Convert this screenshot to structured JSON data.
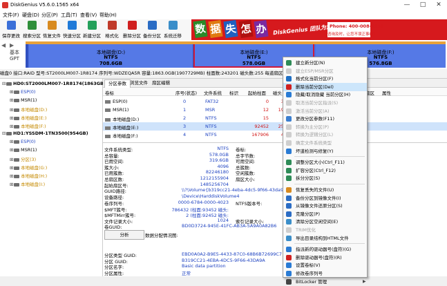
{
  "window": {
    "title": "DiskGenius V5.6.0.1565 x64",
    "controls": [
      "—",
      "□",
      "✕"
    ]
  },
  "menu": [
    "文件(F)",
    "硬盘(D)",
    "分区(P)",
    "工具(T)",
    "查看(V)",
    "帮助(H)"
  ],
  "toolbar": [
    {
      "label": "保存更改",
      "icon": "save-icon",
      "color": "#3a6fd8"
    },
    {
      "label": "搜索分区",
      "icon": "search-icon",
      "color": "#2f8f3a"
    },
    {
      "label": "恢复文件",
      "icon": "recover-icon",
      "color": "#d88a1f"
    },
    {
      "label": "快速分区",
      "icon": "quick-partition-icon",
      "color": "#1f7ad8"
    },
    {
      "label": "新建分区",
      "icon": "new-partition-icon",
      "color": "#24a05a"
    },
    {
      "label": "格式化",
      "icon": "format-icon",
      "color": "#c03a2a"
    },
    {
      "label": "删除分区",
      "icon": "delete-icon",
      "color": "#d02020"
    },
    {
      "label": "备份分区",
      "icon": "backup-icon",
      "color": "#2b6cc4"
    },
    {
      "label": "系统迁移",
      "icon": "migrate-icon",
      "color": "#3b8ec9"
    }
  ],
  "banner": {
    "chars": [
      "数",
      "据",
      "失",
      "怎",
      "办"
    ],
    "slogan": "DiskGenius 团队为您服务",
    "phone": "Phone: 400-008-9958",
    "qq": "咨询及时，让您不误正事QQ",
    "bg_color": "#d6191d"
  },
  "diskmap": {
    "nav_left": "◀",
    "nav_right": "▶",
    "label_line1": "基本",
    "label_line2": "GPT",
    "segments": [
      {
        "name": "本地磁盘(D:)",
        "fs": "NTFS",
        "size": "708.6GB",
        "color": "#5579e6"
      },
      {
        "name": "本地磁盘(E:)",
        "fs": "NTFS",
        "size": "578.0GB",
        "color": "#5579e6"
      },
      {
        "name": "本地磁盘(F:)",
        "fs": "NTFS",
        "size": "576.8GB",
        "color": "#5579e6"
      }
    ]
  },
  "diskinfo": "磁盘0 接口:RAID  型号:ST2000LM007-1R8174  序列号:WDZEQA5R  容量:1863.0GB(1907729MB)  柱面数:243201  磁头数:255  每道扇区数:63  总扇区数:3907029168",
  "tree": [
    {
      "text": "HD0:ST2000LM007-1R8174(1863GB)",
      "exp": "⊟",
      "bold": true,
      "color": "#000"
    },
    {
      "text": "ESP(0)",
      "exp": "⊞",
      "color": "#1a3fc0"
    },
    {
      "text": "MSR(1)",
      "exp": "⊞",
      "color": "#000"
    },
    {
      "text": "本地磁盘(D:)",
      "exp": "⊞",
      "color": "#c58a00"
    },
    {
      "text": "本地磁盘(E:)",
      "exp": "⊞",
      "color": "#c58a00"
    },
    {
      "text": "本地磁盘(F:)",
      "exp": "⊞",
      "color": "#c58a00"
    },
    {
      "text": "HD1:YSSDM-1TN3500(954GB)",
      "exp": "⊟",
      "bold": true,
      "color": "#000"
    },
    {
      "text": "ESP(0)",
      "exp": "⊞",
      "color": "#1a3fc0"
    },
    {
      "text": "MSR(1)",
      "exp": "⊞",
      "color": "#000"
    },
    {
      "text": "分区(3)",
      "exp": "⊞",
      "color": "#c58a00"
    },
    {
      "text": "本地磁盘(G:)",
      "exp": "⊞",
      "color": "#c58a00"
    },
    {
      "text": "本地磁盘(H:)",
      "exp": "⊞",
      "color": "#c58a00"
    },
    {
      "text": "本地磁盘(I:)",
      "exp": "⊞",
      "color": "#c58a00"
    }
  ],
  "tabs": [
    "分区参数",
    "浏览文件",
    "扇区编辑"
  ],
  "table": {
    "headers": [
      "卷标",
      "序号(状态)",
      "文件系统",
      "标识",
      "起始柱面",
      "磁头",
      "扇区",
      "属性"
    ],
    "rows": [
      {
        "vol": "ESP(0)",
        "num": "0",
        "fs": "FAT32",
        "cyl": "0",
        "head": "32",
        "sect": "",
        "attr": "",
        "volc": "bl"
      },
      {
        "vol": "MSR(1)",
        "num": "1",
        "fs": "MSR",
        "cyl": "12",
        "head": "190",
        "sect": "",
        "attr": "",
        "volc": ""
      },
      {
        "vol": "本地磁盘(D:)",
        "num": "2",
        "fs": "NTFS",
        "cyl": "15",
        "head": "",
        "sect": "",
        "attr": "",
        "volc": "bl"
      },
      {
        "vol": "本地磁盘(E:)",
        "num": "3",
        "fs": "NTFS",
        "cyl": "92452",
        "head": "254",
        "sect": "",
        "attr": "",
        "volc": "bl",
        "sel": true
      },
      {
        "vol": "本地磁盘(F:)",
        "num": "4",
        "fs": "NTFS",
        "cyl": "167906",
        "head": "43",
        "sect": "",
        "attr": "",
        "volc": "bl"
      }
    ]
  },
  "details1": [
    {
      "k": "文件系统类型:",
      "v": "NTFS",
      "k2": "卷标:",
      "v2": ""
    },
    {
      "k": "总容量:",
      "v": "578.0GB",
      "k2": "总字节数:",
      "v2": ""
    },
    {
      "k": "已用空间:",
      "v": "319.6GB",
      "k2": "可用空间:",
      "v2": ""
    },
    {
      "k": "簇大小:",
      "v": "4096",
      "k2": "总簇数:",
      "v2": ""
    },
    {
      "k": "已用簇数:",
      "v": "82246180",
      "k2": "空闲簇数:",
      "v2": ""
    },
    {
      "k": "总扇区数:",
      "v": "1212155904",
      "k2": "扇区大小:",
      "v2": ""
    },
    {
      "k": "起始扇区号:",
      "v": "1485256704",
      "k2": "",
      "v2": ""
    },
    {
      "k": "GUID路径:",
      "v": "\\\\?\\Volume{b319cc21-4eba-4dc5-9f66-43da9a8",
      "k2": "",
      "v2": ""
    },
    {
      "k": "设备路径:",
      "v": "\\Device\\HarddiskVolume4",
      "k2": "",
      "v2": ""
    }
  ],
  "details2": [
    {
      "k": "卷序列号:",
      "v": "0000-6784-0000-4023",
      "k2": "NTFS版本号:",
      "v2": ""
    },
    {
      "k": "$MFT簇号:",
      "v": "786432 (柱面:93452 磁头:",
      "k2": "",
      "v2": ""
    },
    {
      "k": "$MFTMirr簇号:",
      "v": "2 (柱面:92452 磁头:",
      "k2": "",
      "v2": ""
    },
    {
      "k": "文件记录大小:",
      "v": "1024",
      "k2": "索引记录大小:",
      "v2": ""
    },
    {
      "k": "卷GUID:",
      "v": "BD0D3724-945E-41FC-AB3A-5A9A0A82B6",
      "k2": "",
      "v2": ""
    }
  ],
  "analyze": {
    "button": "分析",
    "label": "数据分配情况图:"
  },
  "details3": [
    {
      "k": "分区类型 GUID:",
      "v": "EBD0A0A2-B9E5-4433-87C0-68B6B72699C7"
    },
    {
      "k": "分区 GUID:",
      "v": "B319CC21-4EBA-4DC5-9F66-43DA9A"
    },
    {
      "k": "分区名字:",
      "v": "Basic data partition"
    },
    {
      "k": "分区属性:",
      "v": "正常"
    }
  ],
  "context_menu": [
    {
      "label": "建立新分区(N)",
      "icon": "new-partition-icon",
      "color": "#2e8b57",
      "disabled": false
    },
    {
      "label": "建立ESP/MSR分区",
      "icon": "esp-icon",
      "color": "#999999",
      "disabled": true
    },
    {
      "label": "格式化当前分区(F)",
      "icon": "format-icon",
      "color": "#1f6fc4",
      "disabled": false
    },
    {
      "label": "删除当前分区(Del)",
      "icon": "delete-icon",
      "color": "#d02020",
      "disabled": false,
      "highlight": true
    },
    {
      "label": "隐藏/取消隐藏 当前分区(H)",
      "icon": "hide-icon",
      "color": "#2a7bd4",
      "disabled": false
    },
    {
      "label": "取消当前分区指派(S)",
      "icon": "unassign-icon",
      "color": "#999999",
      "disabled": true
    },
    {
      "label": "激活当前分区(A)",
      "icon": "activate-icon",
      "color": "#999999",
      "disabled": true
    },
    {
      "label": "更改分区参数(F11)",
      "icon": "params-icon",
      "color": "#3c7fd0",
      "disabled": false
    },
    {
      "label": "转换为主分区(P)",
      "icon": "convert-icon",
      "color": "#999999",
      "disabled": true
    },
    {
      "label": "转换为逻辑分区(L)",
      "icon": "convert-icon",
      "color": "#999999",
      "disabled": true
    },
    {
      "label": "确定文件系统类型",
      "icon": "check-icon",
      "color": "#999999",
      "disabled": true
    },
    {
      "label": "坏道检测与修复(Y)",
      "icon": "badsector-icon",
      "color": "#2a7bd4",
      "disabled": false
    },
    {
      "sep": true
    },
    {
      "label": "调整分区大小(Ctrl_F11)",
      "icon": "resize-icon",
      "color": "#2e8b57",
      "disabled": false
    },
    {
      "label": "扩容分区(Ctrl_F12)",
      "icon": "extend-icon",
      "color": "#2e8b57",
      "disabled": false
    },
    {
      "label": "拆分分区(S)",
      "icon": "split-icon",
      "color": "#2e8b57",
      "disabled": false
    },
    {
      "sep": true
    },
    {
      "label": "恢复丢失的文件(U)",
      "icon": "recover-icon",
      "color": "#d88a1f",
      "disabled": false
    },
    {
      "label": "备份分区到镜像文件(I)",
      "icon": "backup-icon",
      "color": "#2b6cc4",
      "disabled": false
    },
    {
      "label": "从镜像文件还原分区(S)",
      "icon": "restore-icon",
      "color": "#2b6cc4",
      "disabled": false
    },
    {
      "label": "克隆分区(P)",
      "icon": "clone-icon",
      "color": "#2b6cc4",
      "disabled": false
    },
    {
      "label": "清除分区空闲空间(E)",
      "icon": "wipe-icon",
      "color": "#3b8ec9",
      "disabled": false
    },
    {
      "label": "TRIM优化",
      "icon": "trim-icon",
      "color": "#999999",
      "disabled": true
    },
    {
      "label": "导出目录结构到HTML文件",
      "icon": "export-icon",
      "color": "#3b8ec9",
      "disabled": false
    },
    {
      "sep": true
    },
    {
      "label": "指派新的驱动器号(盘符)(G)",
      "icon": "drive-letter-icon",
      "color": "#2a7bd4",
      "disabled": false
    },
    {
      "label": "删除驱动器号(盘符)(R)",
      "icon": "remove-letter-icon",
      "color": "#d02020",
      "disabled": false
    },
    {
      "label": "设置卷标(V)",
      "icon": "label-icon",
      "color": "#2a7bd4",
      "disabled": false
    },
    {
      "label": "修改卷序列号",
      "icon": "serial-icon",
      "color": "#2a7bd4",
      "disabled": false
    },
    {
      "label": "BitLocker 管理",
      "icon": "lock-icon",
      "color": "#444444",
      "disabled": false,
      "arrow": "▶"
    }
  ]
}
